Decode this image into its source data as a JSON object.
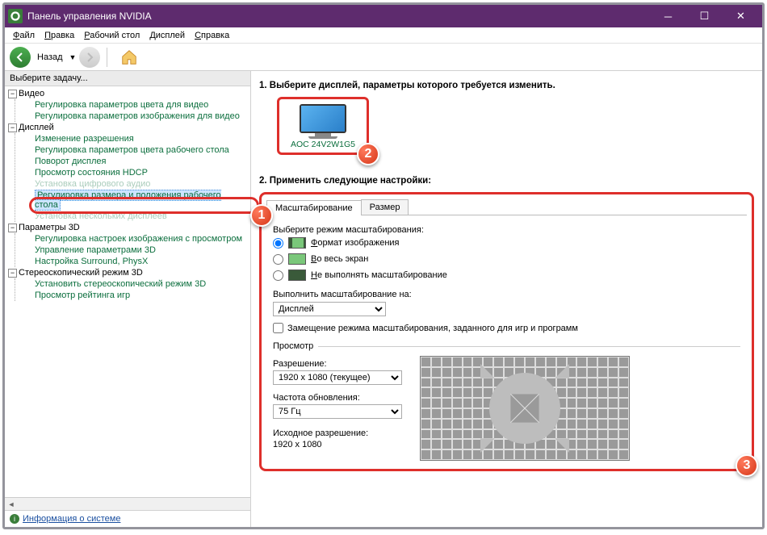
{
  "titlebar": {
    "title": "Панель управления NVIDIA"
  },
  "menubar": {
    "file": "Файл",
    "edit": "Правка",
    "desktop": "Рабочий стол",
    "display": "Дисплей",
    "help": "Справка"
  },
  "toolbar": {
    "back": "Назад"
  },
  "sidebar": {
    "header": "Выберите задачу...",
    "video": {
      "label": "Видео",
      "items": [
        "Регулировка параметров цвета для видео",
        "Регулировка параметров изображения для видео"
      ]
    },
    "display": {
      "label": "Дисплей",
      "items": [
        "Изменение разрешения",
        "Регулировка параметров цвета рабочего стола",
        "Поворот дисплея",
        "Просмотр состояния HDCP",
        "Установка цифрового аудио",
        "Регулировка размера и положения рабочего стола",
        "Установка нескольких дисплеев"
      ]
    },
    "params3d": {
      "label": "Параметры 3D",
      "items": [
        "Регулировка настроек изображения с просмотром",
        "Управление параметрами 3D",
        "Настройка Surround, PhysX"
      ]
    },
    "stereo": {
      "label": "Стереоскопический режим 3D",
      "items": [
        "Установить стереоскопический режим 3D",
        "Просмотр рейтинга игр"
      ]
    },
    "footer": "Информация о системе"
  },
  "content": {
    "step1": "1. Выберите дисплей, параметры которого требуется изменить.",
    "display_name": "AOC 24V2W1G5",
    "step2": "2. Применить следующие настройки:",
    "tabs": {
      "scaling": "Масштабирование",
      "size": "Размер"
    },
    "scaling_mode_label": "Выберите режим масштабирования:",
    "modes": {
      "aspect": "Формат изображения",
      "full": "Во весь экран",
      "none": "Не выполнять масштабирование"
    },
    "perform_on_label": "Выполнить масштабирование на:",
    "perform_on_value": "Дисплей",
    "override_label": "Замещение режима масштабирования, заданного для игр и программ",
    "preview_legend": "Просмотр",
    "resolution_label": "Разрешение:",
    "resolution_value": "1920 x 1080 (текущее)",
    "refresh_label": "Частота обновления:",
    "refresh_value": "75 Гц",
    "native_label": "Исходное разрешение:",
    "native_value": "1920 x 1080"
  }
}
